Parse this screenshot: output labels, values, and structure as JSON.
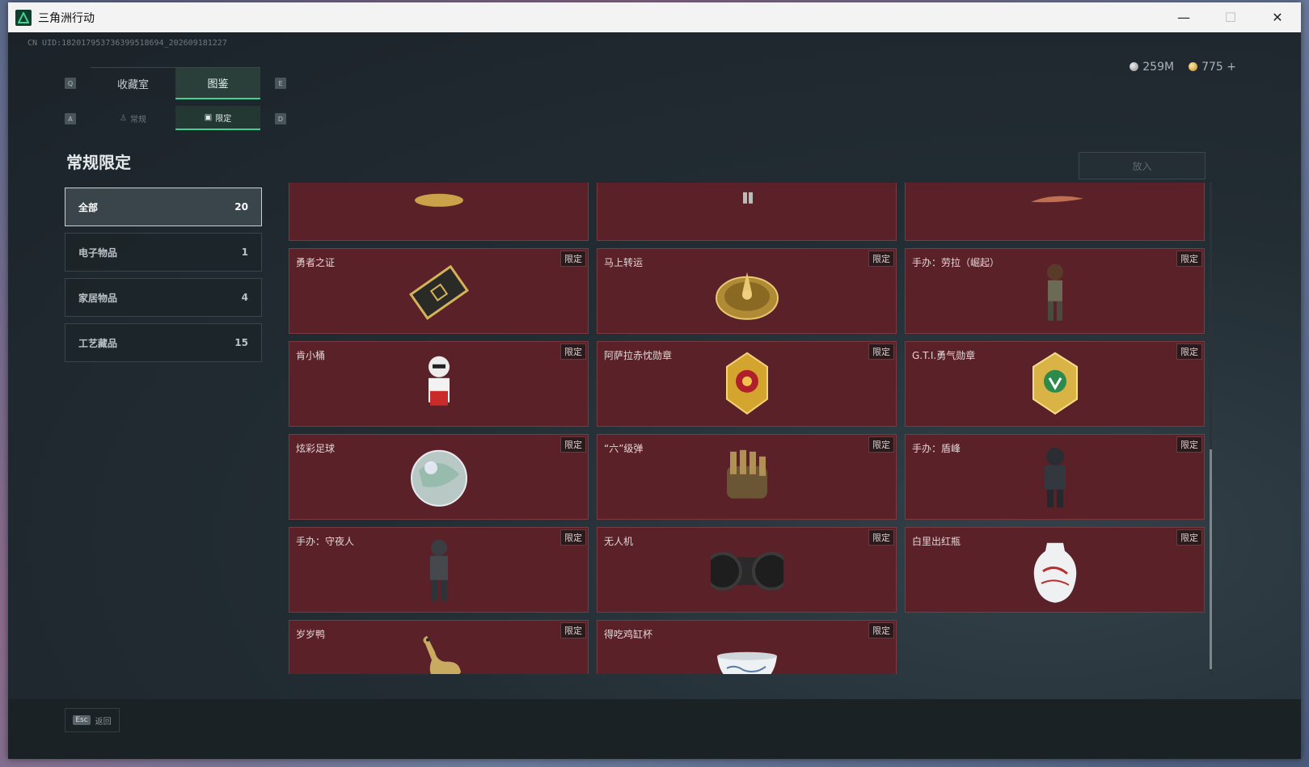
{
  "window": {
    "title": "三角洲行动",
    "minimize": "—",
    "maximize": "☐",
    "close": "✕"
  },
  "uid": "CN UID:182017953736399518694_202609181227",
  "currency": {
    "silver": "259M",
    "gold": "775",
    "add": "+"
  },
  "keys": {
    "q": "Q",
    "e": "E",
    "a": "A",
    "d": "D",
    "esc": "Esc"
  },
  "tabs_main": [
    {
      "label": "收藏室"
    },
    {
      "label": "图鉴"
    }
  ],
  "tabs_sub": [
    {
      "label": "常规"
    },
    {
      "label": "限定"
    }
  ],
  "section_title": "常规限定",
  "categories": [
    {
      "label": "全部",
      "count": "20"
    },
    {
      "label": "电子物品",
      "count": "1"
    },
    {
      "label": "家居物品",
      "count": "4"
    },
    {
      "label": "工艺藏品",
      "count": "15"
    }
  ],
  "put_button": "放入",
  "badge": "限定",
  "items": [
    {
      "name": "",
      "icon": "gold-ornament-icon"
    },
    {
      "name": "",
      "icon": "figure-legs-icon"
    },
    {
      "name": "",
      "icon": "feather-icon"
    },
    {
      "name": "勇者之证",
      "icon": "diamond-badge-icon"
    },
    {
      "name": "马上转运",
      "icon": "gold-compass-icon"
    },
    {
      "name": "手办：劳拉（崛起）",
      "icon": "figure-lara-icon"
    },
    {
      "name": "肯小桶",
      "icon": "colonel-figure-icon"
    },
    {
      "name": "阿萨拉赤忱勋章",
      "icon": "red-medal-icon"
    },
    {
      "name": "G.T.I.勇气勋章",
      "icon": "green-medal-icon"
    },
    {
      "name": "炫彩足球",
      "icon": "iridescent-ball-icon"
    },
    {
      "name": "“六”级弹",
      "icon": "bullet-hand-icon"
    },
    {
      "name": "手办：盾峰",
      "icon": "figure-shield-icon"
    },
    {
      "name": "手办：守夜人",
      "icon": "figure-nightwatch-icon"
    },
    {
      "name": "无人机",
      "icon": "drone-roller-icon"
    },
    {
      "name": "白里出红瓶",
      "icon": "porcelain-vase-icon"
    },
    {
      "name": "岁岁鸭",
      "icon": "brass-duck-icon"
    },
    {
      "name": "得吃鸡缸杯",
      "icon": "porcelain-cup-icon"
    }
  ],
  "back_label": "返回",
  "colors": {
    "card_bg": "#5a2128",
    "accent": "#3fd18f"
  }
}
